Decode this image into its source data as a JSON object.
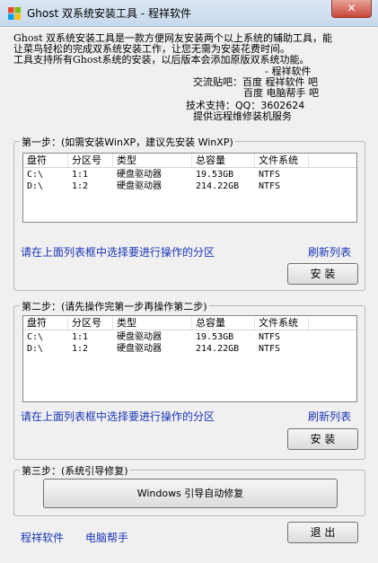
{
  "window": {
    "title": "Ghost 双系统安装工具 - 程祥软件",
    "close_label": "✕"
  },
  "intro": {
    "line1": "Ghost 双系统安装工具是一款方便网友安装两个以上系统的辅助工具，能",
    "line2": "让菜鸟轻松的完成双系统安装工作，让您无需为安装花费时间。",
    "line3": "工具支持所有Ghost系统的安装，以后版本会添加原版双系统功能。",
    "sign": "- 程祥软件",
    "forum_label": "交流贴吧：百度 程祥软件 吧",
    "forum_line2": "百度 电脑帮手 吧",
    "support": "技术支持：QQ：3602624",
    "service": "提供远程维修装机服务"
  },
  "columns": [
    "盘符",
    "分区号",
    "类型",
    "总容量",
    "文件系统"
  ],
  "step1": {
    "title": "第一步：(如需安装WinXP，建议先安装 WinXP)",
    "rows": [
      {
        "drive": "C:\\",
        "partition": "1:1",
        "type": "硬盘驱动器",
        "size": "19.53GB",
        "fs": "NTFS"
      },
      {
        "drive": "D:\\",
        "partition": "1:2",
        "type": "硬盘驱动器",
        "size": "214.22GB",
        "fs": "NTFS"
      }
    ],
    "hint": "请在上面列表框中选择要进行操作的分区",
    "refresh": "刷新列表",
    "install": "安 装"
  },
  "step2": {
    "title": "第二步：(请先操作完第一步再操作第二步)",
    "rows": [
      {
        "drive": "C:\\",
        "partition": "1:1",
        "type": "硬盘驱动器",
        "size": "19.53GB",
        "fs": "NTFS"
      },
      {
        "drive": "D:\\",
        "partition": "1:2",
        "type": "硬盘驱动器",
        "size": "214.22GB",
        "fs": "NTFS"
      }
    ],
    "hint": "请在上面列表框中选择要进行操作的分区",
    "refresh": "刷新列表",
    "install": "安 装"
  },
  "step3": {
    "title": "第三步：(系统引导修复)",
    "repair": "Windows 引导自动修复"
  },
  "footer": {
    "link1": "程祥软件",
    "link2": "电脑帮手",
    "exit": "退 出"
  }
}
